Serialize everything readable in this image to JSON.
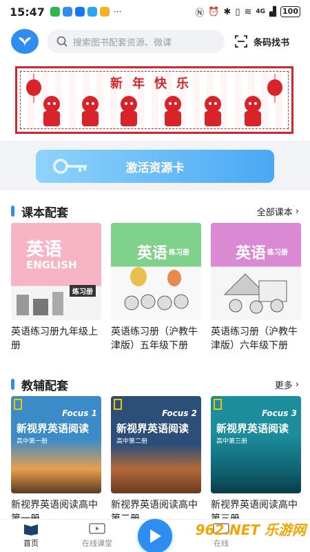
{
  "status_bar": {
    "time": "15:47",
    "signal": "4G",
    "battery": "100"
  },
  "header": {
    "search_placeholder": "搜索图书配套资源、微课",
    "barcode_label": "条码找书"
  },
  "banner": {
    "title": "新年快乐"
  },
  "activation": {
    "label": "激活资源卡"
  },
  "textbook_section": {
    "title": "课本配套",
    "more_label": "全部课本",
    "books": [
      {
        "title": "英语练习册九年级上册",
        "cover_text": "英语",
        "cover_sub": "ENGLISH",
        "cover_badge": "练习册"
      },
      {
        "title": "英语练习册（沪教牛津版）五年级下册",
        "cover_text": "英语",
        "cover_sub": "练习册"
      },
      {
        "title": "英语练习册（沪教牛津版）六年级下册",
        "cover_text": "英语",
        "cover_sub": "练习册"
      }
    ]
  },
  "supplement_section": {
    "title": "教辅配套",
    "more_label": "更多",
    "books": [
      {
        "title": "新视界英语阅读高中第一册",
        "cover_text": "新视界英语阅读",
        "focus": "Focus 1",
        "grade": "高中第一册"
      },
      {
        "title": "新视界英语阅读高中第二册",
        "cover_text": "新视界英语阅读",
        "focus": "Focus 2",
        "grade": "高中第二册"
      },
      {
        "title": "新视界英语阅读高中第三册",
        "cover_text": "新视界英语阅读",
        "focus": "Focus 3",
        "grade": "高中第三册"
      }
    ]
  },
  "tabbar": {
    "items": [
      {
        "label": "首页"
      },
      {
        "label": "在线课堂"
      },
      {
        "label": "在线"
      }
    ]
  },
  "watermark": "962.NET 乐游网",
  "colors": {
    "accent": "#2e8df0",
    "banner_red": "#d8232a"
  }
}
